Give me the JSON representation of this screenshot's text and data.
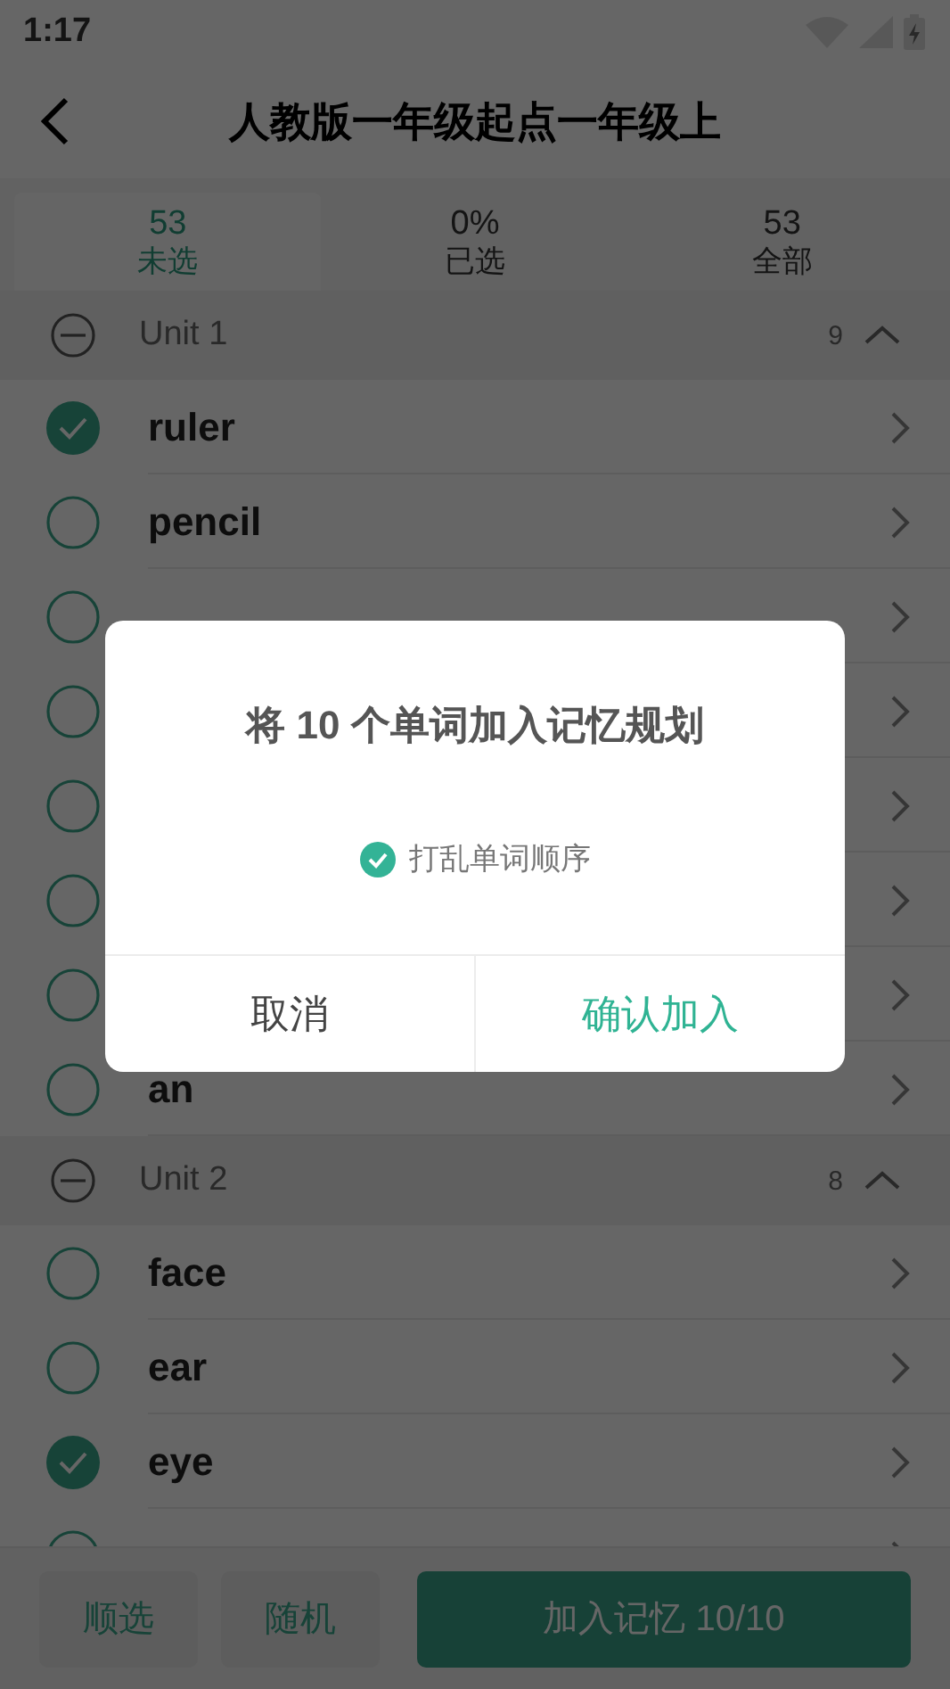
{
  "status_bar": {
    "time": "1:17"
  },
  "header": {
    "title": "人教版一年级起点一年级上"
  },
  "tabs": [
    {
      "count": "53",
      "label": "未选",
      "selected": true
    },
    {
      "count": "0%",
      "label": "已选",
      "selected": false
    },
    {
      "count": "53",
      "label": "全部",
      "selected": false
    }
  ],
  "units": [
    {
      "title": "Unit 1",
      "count": "9",
      "expanded": true,
      "words": [
        {
          "word": "ruler",
          "checked": true
        },
        {
          "word": "pencil",
          "checked": false
        },
        {
          "checked": false
        },
        {
          "checked": false
        },
        {
          "checked": false
        },
        {
          "checked": false
        },
        {
          "checked": false
        },
        {
          "word": "an",
          "checked": false
        }
      ]
    },
    {
      "title": "Unit 2",
      "count": "8",
      "expanded": true,
      "words": [
        {
          "word": "face",
          "checked": false
        },
        {
          "word": "ear",
          "checked": false
        },
        {
          "word": "eye",
          "checked": true
        },
        {
          "checked": false
        }
      ]
    }
  ],
  "bottom_bar": {
    "buttons": [
      "顺选",
      "随机"
    ],
    "primary": "加入记忆 10/10"
  },
  "dialog": {
    "title": "将 10 个单词加入记忆规划",
    "option": {
      "label": "打乱单词顺序",
      "checked": true
    },
    "cancel": "取消",
    "confirm": "确认加入"
  }
}
